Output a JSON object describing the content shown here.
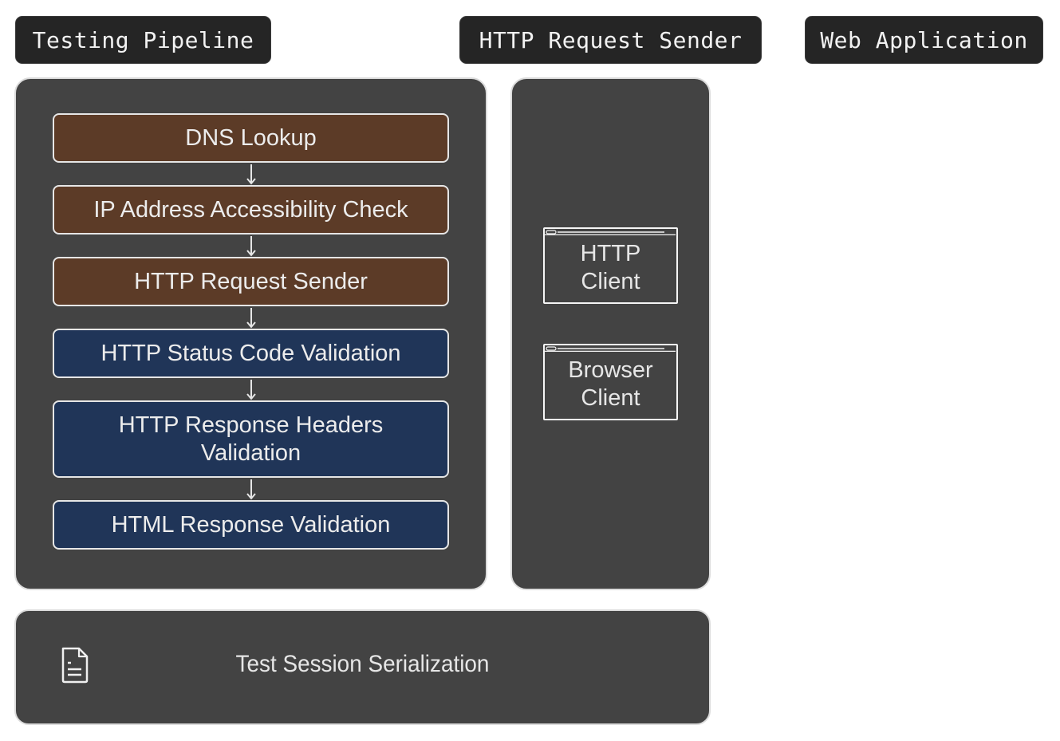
{
  "lanes": [
    {
      "label": "Testing Pipeline"
    },
    {
      "label": "HTTP Request Sender"
    },
    {
      "label": "Web Application"
    }
  ],
  "pipeline": {
    "steps": [
      {
        "label": "DNS Lookup",
        "color": "#5c3b27"
      },
      {
        "label": "IP Address Accessibility Check",
        "color": "#5c3b27"
      },
      {
        "label": "HTTP Request Sender",
        "color": "#5c3b27"
      },
      {
        "label": "HTTP Status Code Validation",
        "color": "#203558"
      },
      {
        "label": "HTTP Response Headers Validation",
        "color": "#203558"
      },
      {
        "label": "HTML Response Validation",
        "color": "#203558"
      }
    ]
  },
  "sender": {
    "clients": [
      {
        "label": "HTTP Client",
        "icon": "browser-window-icon"
      },
      {
        "label": "Browser Client",
        "icon": "browser-window-icon"
      }
    ]
  },
  "serialization": {
    "label": "Test Session Serialization",
    "icon": "document-icon"
  },
  "colors": {
    "panel": "#434343",
    "lane_label_bg": "#252525",
    "brown_step": "#5c3b27",
    "blue_step": "#203558"
  }
}
